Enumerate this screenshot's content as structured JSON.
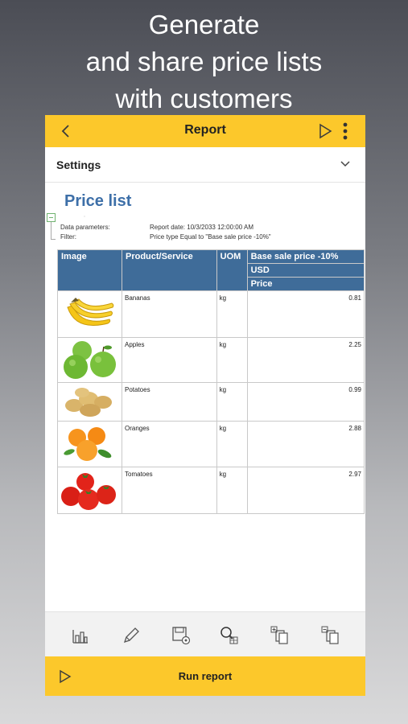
{
  "promo": {
    "line1": "Generate",
    "line2": "and share price lists",
    "line3": "with customers"
  },
  "topbar": {
    "title": "Report",
    "back_icon": "chevron-left-icon",
    "run_icon": "play-icon",
    "menu_icon": "more-vertical-icon"
  },
  "settings": {
    "label": "Settings",
    "icon": "chevron-down-icon"
  },
  "report": {
    "title": "Price list",
    "params": [
      {
        "label": "Data parameters:",
        "value": "Report date: 10/3/2033 12:00:00 AM"
      },
      {
        "label": "Filter:",
        "value": "Price type Equal to \"Base sale price -10%\""
      }
    ],
    "table": {
      "headers": {
        "image": "Image",
        "product": "Product/Service",
        "uom": "UOM",
        "price_type": "Base sale price -10%",
        "currency": "USD",
        "price": "Price"
      },
      "rows": [
        {
          "product": "Bananas",
          "uom": "kg",
          "price": "0.81",
          "image": "bananas-image"
        },
        {
          "product": "Apples",
          "uom": "kg",
          "price": "2.25",
          "image": "apples-image"
        },
        {
          "product": "Potatoes",
          "uom": "kg",
          "price": "0.99",
          "image": "potatoes-image"
        },
        {
          "product": "Oranges",
          "uom": "kg",
          "price": "2.88",
          "image": "oranges-image"
        },
        {
          "product": "Tomatoes",
          "uom": "kg",
          "price": "2.97",
          "image": "tomatoes-image"
        }
      ]
    }
  },
  "toolbar": {
    "icons": [
      "chart-icon",
      "pencil-icon",
      "save-settings-icon",
      "search-in-table-icon",
      "add-copy-icon",
      "remove-copy-icon"
    ]
  },
  "run": {
    "label": "Run report",
    "icon": "play-icon"
  },
  "colors": {
    "accent": "#fcc82b",
    "table_header": "#3f6c99",
    "title_blue": "#3d6fa8"
  }
}
